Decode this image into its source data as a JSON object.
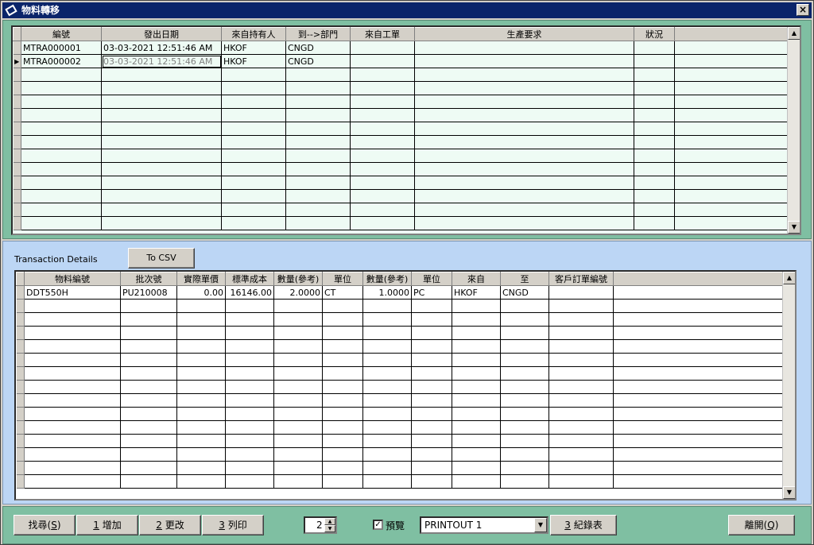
{
  "window": {
    "title": "物料轉移"
  },
  "top_grid": {
    "columns": [
      "編號",
      "發出日期",
      "來自持有人",
      "到-->部門",
      "來自工單",
      "生產要求",
      "狀況"
    ],
    "rows": [
      [
        "MTRA000001",
        "03-03-2021 12:51:46 AM",
        "HKOF",
        "CNGD",
        "",
        "",
        ""
      ],
      [
        "MTRA000002",
        "03-03-2021 12:51:46 AM",
        "HKOF",
        "CNGD",
        "",
        "",
        ""
      ]
    ]
  },
  "details": {
    "label": "Transaction Details",
    "csv_button": "To CSV",
    "columns": [
      "物料編號",
      "批次號",
      "實際單價",
      "標準成本",
      "數量(參考)",
      "單位",
      "數量(參考)",
      "單位",
      "來自",
      "至",
      "客戶訂單編號"
    ],
    "rows": [
      [
        "DDT550H",
        "PU210008",
        "0.00",
        "16146.00",
        "2.0000",
        "CT",
        "1.0000",
        "PC",
        "HKOF",
        "CNGD",
        ""
      ]
    ]
  },
  "toolbar": {
    "find": {
      "prefix": "找尋(",
      "key": "S",
      "suffix": ")"
    },
    "add": {
      "key": "1",
      "label": " 增加"
    },
    "edit": {
      "key": "2",
      "label": " 更改"
    },
    "print": {
      "key": "3",
      "label": " 列印"
    },
    "copies": "2",
    "preview_label": "預覽",
    "preview_checked": true,
    "printout": "PRINTOUT 1",
    "report": {
      "key": "3",
      "label": " 紀錄表"
    },
    "exit": {
      "prefix": "離開(",
      "key": "Q",
      "suffix": ")"
    }
  }
}
